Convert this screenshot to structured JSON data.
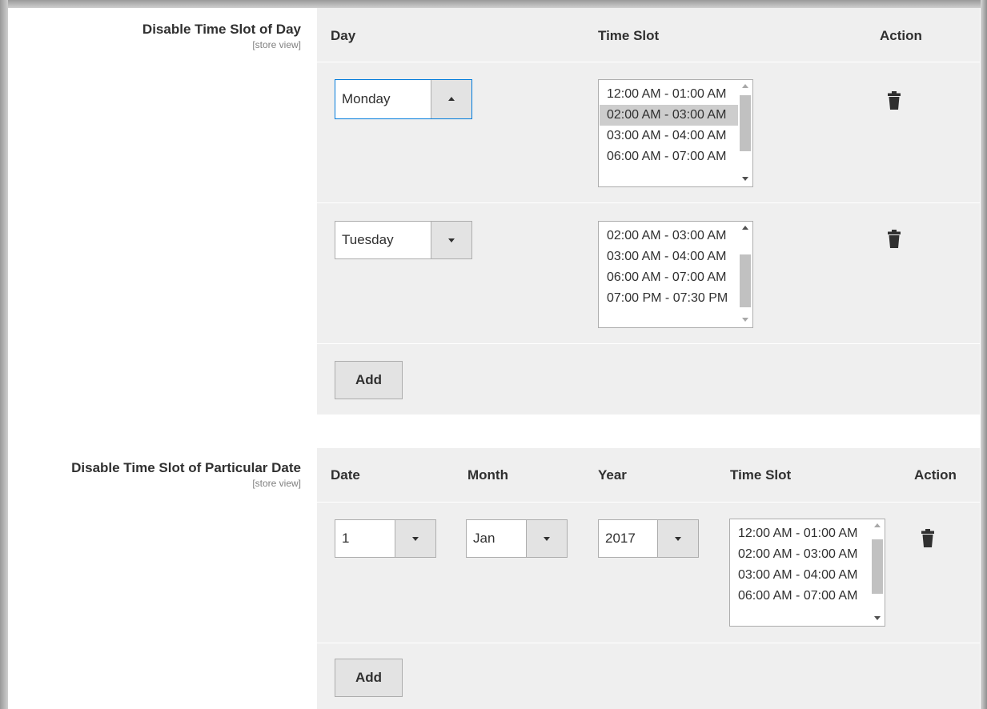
{
  "section_day": {
    "label": "Disable Time Slot of Day",
    "scope": "[store view]",
    "headers": {
      "day": "Day",
      "time_slot": "Time Slot",
      "action": "Action"
    },
    "rows": [
      {
        "day": "Monday",
        "slots": [
          "12:00 AM - 01:00 AM",
          "02:00 AM - 03:00 AM",
          "03:00 AM - 04:00 AM",
          "06:00 AM - 07:00 AM"
        ],
        "selected_slot": "02:00 AM - 03:00 AM"
      },
      {
        "day": "Tuesday",
        "slots": [
          "02:00 AM - 03:00 AM",
          "03:00 AM - 04:00 AM",
          "06:00 AM - 07:00 AM",
          "07:00 PM - 07:30 PM"
        ]
      }
    ],
    "add_label": "Add"
  },
  "section_date": {
    "label": "Disable Time Slot of Particular Date",
    "scope": "[store view]",
    "headers": {
      "date": "Date",
      "month": "Month",
      "year": "Year",
      "time_slot": "Time Slot",
      "action": "Action"
    },
    "rows": [
      {
        "date": "1",
        "month": "Jan",
        "year": "2017",
        "slots": [
          "12:00 AM - 01:00 AM",
          "02:00 AM - 03:00 AM",
          "03:00 AM - 04:00 AM",
          "06:00 AM - 07:00 AM"
        ]
      }
    ],
    "add_label": "Add"
  },
  "icons": {
    "delete": "trash-icon",
    "dropdown": "chevron-down-icon",
    "dropdown_open": "chevron-up-icon"
  },
  "colors": {
    "panel": "#efefef",
    "focus_border": "#007bdb",
    "button": "#e3e3e3",
    "selected_option": "#cdcdcd"
  }
}
